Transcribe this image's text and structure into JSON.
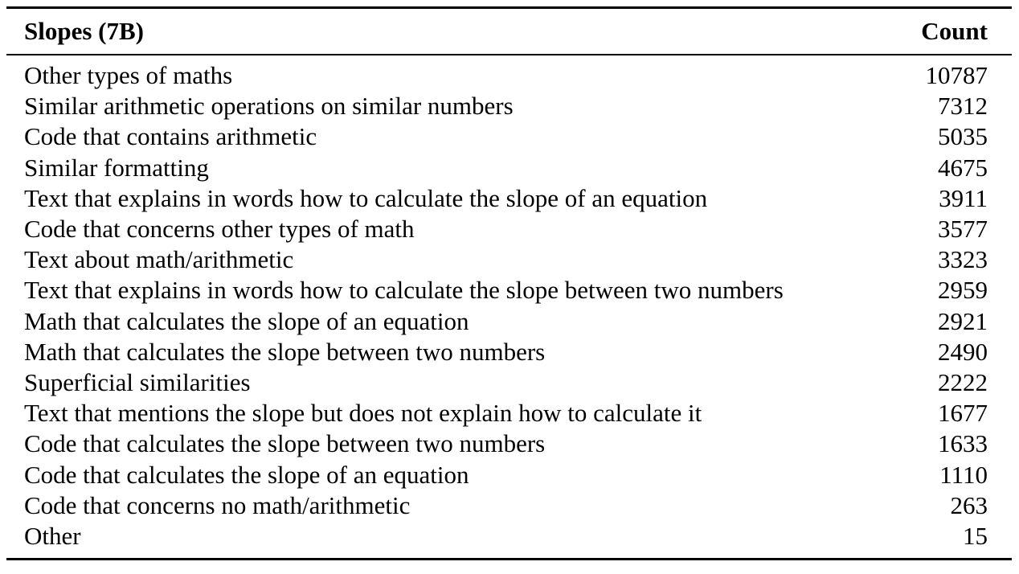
{
  "table": {
    "header": {
      "label": "Slopes (7B)",
      "count": "Count"
    },
    "rows": [
      {
        "label": "Other types of maths",
        "count": "10787"
      },
      {
        "label": "Similar arithmetic operations on similar numbers",
        "count": "7312"
      },
      {
        "label": "Code that contains arithmetic",
        "count": "5035"
      },
      {
        "label": "Similar formatting",
        "count": "4675"
      },
      {
        "label": "Text that explains in words how to calculate the slope of an equation",
        "count": "3911"
      },
      {
        "label": "Code that concerns other types of math",
        "count": "3577"
      },
      {
        "label": "Text about math/arithmetic",
        "count": "3323"
      },
      {
        "label": "Text that explains in words how to calculate the slope between two numbers",
        "count": "2959"
      },
      {
        "label": "Math that calculates the slope of an equation",
        "count": "2921"
      },
      {
        "label": "Math that calculates the slope between two numbers",
        "count": "2490"
      },
      {
        "label": "Superficial similarities",
        "count": "2222"
      },
      {
        "label": "Text that mentions the slope but does not explain how to calculate it",
        "count": "1677"
      },
      {
        "label": "Code that calculates the slope between two numbers",
        "count": "1633"
      },
      {
        "label": "Code that calculates the slope of an equation",
        "count": "1110"
      },
      {
        "label": "Code that concerns no math/arithmetic",
        "count": "263"
      },
      {
        "label": "Other",
        "count": "15"
      }
    ]
  }
}
